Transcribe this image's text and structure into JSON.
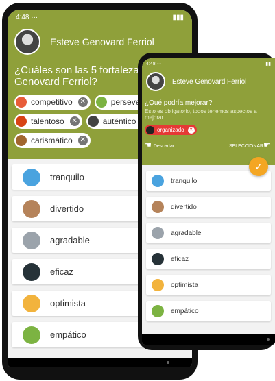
{
  "back_screen": {
    "status_time": "4:48",
    "status_dots": "···",
    "profile_name": "Esteve Genovard Ferriol",
    "question_line1": "¿Cuáles son las 5 fortalezas de",
    "question_line2": "Genovard Ferriol?",
    "chips": [
      {
        "label": "competitivo",
        "icon": "rooster-icon",
        "color": "#e85d3a"
      },
      {
        "label": "perseverante",
        "icon": "owl-icon",
        "color": "#7cb342"
      },
      {
        "label": "talentoso",
        "icon": "rooster-icon",
        "color": "#d84315"
      },
      {
        "label": "auténtico",
        "icon": "panda-icon",
        "color": "#424242"
      },
      {
        "label": "carismático",
        "icon": "lion-icon",
        "color": "#a1662f"
      }
    ],
    "list_items": [
      {
        "label": "tranquilo",
        "icon": "whale-icon",
        "color": "#4aa3df"
      },
      {
        "label": "divertido",
        "icon": "monkey-icon",
        "color": "#b5835a"
      },
      {
        "label": "agradable",
        "icon": "koala-icon",
        "color": "#9ba3ab"
      },
      {
        "label": "eficaz",
        "icon": "penguin-icon",
        "color": "#263238"
      },
      {
        "label": "optimista",
        "icon": "giraffe-icon",
        "color": "#f2b33d"
      },
      {
        "label": "empático",
        "icon": "turtle-icon",
        "color": "#7cb342"
      }
    ]
  },
  "front_screen": {
    "status_time": "4:48",
    "status_dots": "···",
    "profile_name": "Esteve Genovard Ferriol",
    "question": "¿Qué podría mejorar?",
    "hint_line1": "Esto es obligatorio, todos tenemos aspectos a",
    "hint_line2": "mejorar.",
    "chip": {
      "label": "organizado",
      "icon": "ant-icon",
      "color": "#e53935"
    },
    "discard_label": "Descartar",
    "select_label": "SELECCIONAR",
    "list_items": [
      {
        "label": "tranquilo",
        "icon": "whale-icon",
        "color": "#4aa3df"
      },
      {
        "label": "divertido",
        "icon": "monkey-icon",
        "color": "#b5835a"
      },
      {
        "label": "agradable",
        "icon": "koala-icon",
        "color": "#9ba3ab"
      },
      {
        "label": "eficaz",
        "icon": "penguin-icon",
        "color": "#263238"
      },
      {
        "label": "optimista",
        "icon": "giraffe-icon",
        "color": "#f2b33d"
      },
      {
        "label": "empático",
        "icon": "turtle-icon",
        "color": "#7cb342"
      }
    ]
  },
  "colors": {
    "header": "#8fa03a",
    "fab": "#f4a623",
    "remove_chip": "#e53935"
  }
}
